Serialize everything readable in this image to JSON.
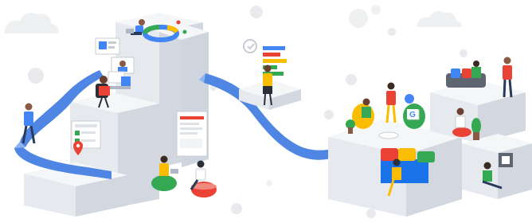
{
  "illustration": {
    "description_tags": [
      "isometric",
      "collaboration",
      "workspace"
    ],
    "palette": {
      "block_light": "#f1f3f5",
      "block_mid": "#e3e7ec",
      "block_dark": "#cfd5de",
      "ribbon_blue": "#4f86e3",
      "ribbon_blue_light": "#8fb3f0",
      "google_blue": "#4285f4",
      "google_red": "#ea4335",
      "google_yellow": "#fbbc04",
      "google_green": "#34a853",
      "cloud": "#eef0f2",
      "bubble": "#e8eaed"
    },
    "icons": [
      "cloud-icon",
      "location-pin-icon",
      "google-g-icon",
      "donut-chart-icon",
      "bar-chart-icon"
    ]
  }
}
